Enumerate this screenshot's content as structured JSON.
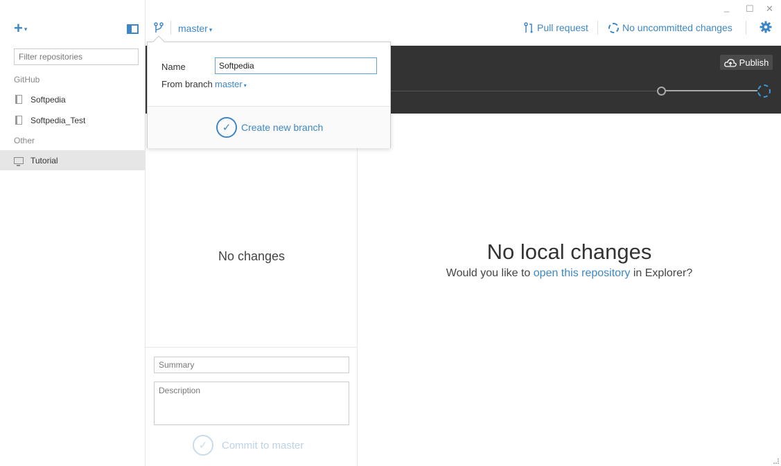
{
  "sidebar": {
    "add_caret": "▾",
    "filter_placeholder": "Filter repositories",
    "groups": [
      {
        "label": "GitHub",
        "items": [
          {
            "label": "Softpedia"
          },
          {
            "label": "Softpedia_Test"
          }
        ]
      },
      {
        "label": "Other",
        "items": [
          {
            "label": "Tutorial",
            "active": true
          }
        ]
      }
    ]
  },
  "toolbar": {
    "branch": "master",
    "caret": "▾",
    "pull_request": "Pull request",
    "uncommitted": "No uncommitted changes",
    "win_minimize": "_",
    "win_maximize": "☐",
    "win_close": "✕"
  },
  "history": {
    "publish_label": "Publish"
  },
  "changes": {
    "empty_label": "No changes",
    "summary_placeholder": "Summary",
    "description_placeholder": "Description",
    "commit_label": "Commit to master",
    "check_glyph": "✓"
  },
  "main": {
    "title": "No local changes",
    "sub_before": "Would you like to ",
    "sub_link": "open this repository",
    "sub_after": " in Explorer?"
  },
  "popup": {
    "name_label": "Name",
    "name_value": "Softpedia",
    "from_label": "From branch",
    "from_value": "master",
    "caret": "▾",
    "create_label": "Create new branch",
    "check_glyph": "✓"
  },
  "colors": {
    "accent": "#3d87c7",
    "history_bg": "#333333",
    "active_repo_bg": "#e6e6e6"
  },
  "icons": {
    "add": "plus-icon",
    "sidebar_toggle": "panel-toggle-icon",
    "branch": "branch-icon",
    "pull_request": "pull-request-icon",
    "sync": "sync-ring-icon",
    "settings": "gear-icon",
    "publish": "cloud-upload-icon",
    "repo_github": "book-icon",
    "repo_other": "monitor-icon"
  }
}
